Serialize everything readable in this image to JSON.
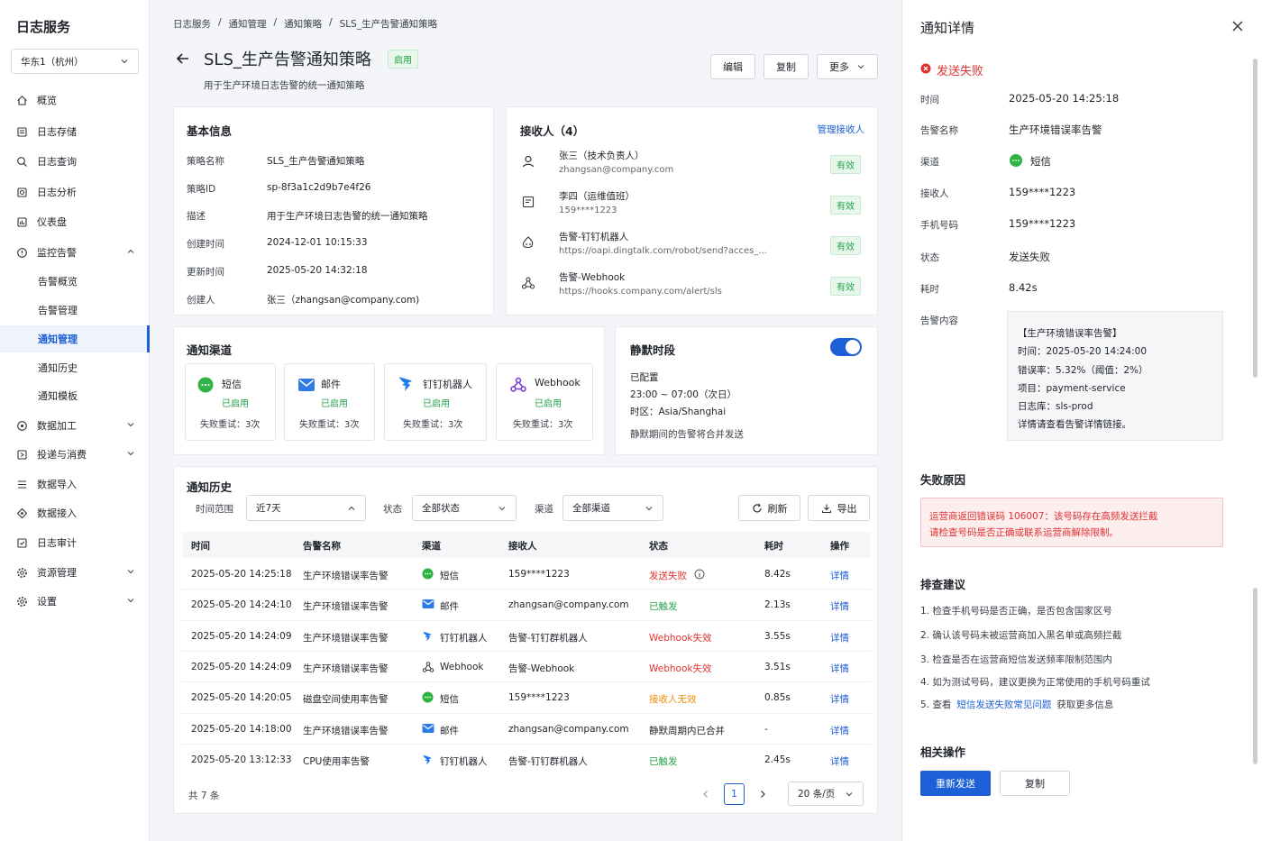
{
  "sidebar": {
    "brand": "日志服务",
    "region": "华东1（杭州）",
    "items": [
      {
        "label": "概览",
        "icon": "home-icon"
      },
      {
        "label": "日志存储",
        "icon": "storage-icon"
      },
      {
        "label": "日志查询",
        "icon": "search-icon"
      },
      {
        "label": "日志分析",
        "icon": "analysis-icon"
      },
      {
        "label": "仪表盘",
        "icon": "dashboard-icon"
      },
      {
        "label": "监控告警",
        "icon": "alert-icon"
      },
      {
        "label": "告警概览"
      },
      {
        "label": "告警管理"
      },
      {
        "label": "通知管理"
      },
      {
        "label": "通知历史"
      },
      {
        "label": "通知模板"
      },
      {
        "label": "数据加工",
        "icon": "process-icon"
      },
      {
        "label": "投递与消费",
        "icon": "deliver-icon"
      },
      {
        "label": "数据导入",
        "icon": "import-icon"
      },
      {
        "label": "数据接入",
        "icon": "access-icon"
      },
      {
        "label": "日志审计",
        "icon": "audit-icon"
      },
      {
        "label": "资源管理",
        "icon": "resource-icon"
      },
      {
        "label": "设置",
        "icon": "gear-icon"
      }
    ]
  },
  "breadcrumb": [
    "日志服务",
    "通知管理",
    "通知策略",
    "SLS_生产告警通知策略"
  ],
  "breadcrumb_sep": "/",
  "header": {
    "title": "SLS_生产告警通知策略",
    "status": "启用",
    "subtitle": "用于生产环境日志告警的统一通知策略",
    "edit": "编辑",
    "copy": "复制",
    "more": "更多"
  },
  "basic": {
    "title": "基本信息",
    "rows": [
      {
        "k": "策略名称",
        "v": "SLS_生产告警通知策略"
      },
      {
        "k": "策略ID",
        "v": "sp-8f3a1c2d9b7e4f26"
      },
      {
        "k": "描述",
        "v": "用于生产环境日志告警的统一通知策略"
      },
      {
        "k": "创建时间",
        "v": "2024-12-01 10:15:33"
      },
      {
        "k": "更新时间",
        "v": "2025-05-20 14:32:18"
      },
      {
        "k": "创建人",
        "v": "张三（zhangsan@company.com)"
      }
    ]
  },
  "receivers": {
    "title": "接收人（4）",
    "manage": "管理接收人",
    "items": [
      {
        "name": "张三（技术负责人）",
        "detail": "zhangsan@company.com",
        "status": "有效",
        "icon": "user-icon"
      },
      {
        "name": "李四（运维值班）",
        "detail": "159****1223",
        "status": "有效",
        "icon": "phone-icon"
      },
      {
        "name": "告警-钉钉机器人",
        "detail": "https://oapi.dingtalk.com/robot/send?acces_...",
        "status": "有效",
        "icon": "robot-icon"
      },
      {
        "name": "告警-Webhook",
        "detail": "https://hooks.company.com/alert/sls",
        "status": "有效",
        "icon": "webhook-icon"
      }
    ]
  },
  "channels": {
    "title": "通知渠道",
    "items": [
      {
        "name": "短信",
        "state": "已启用",
        "retry": "失败重试：3次",
        "icon": "sms-icon",
        "color": "#2fb344"
      },
      {
        "name": "邮件",
        "state": "已启用",
        "retry": "失败重试：3次",
        "icon": "mail-icon",
        "color": "#2f7be5"
      },
      {
        "name": "钉钉机器人",
        "state": "已启用",
        "retry": "失败重试：3次",
        "icon": "dingtalk-icon",
        "color": "#1d7bf0"
      },
      {
        "name": "Webhook",
        "state": "已启用",
        "retry": "失败重试：3次",
        "icon": "webhook-icon",
        "color": "#7b3fd6"
      }
    ]
  },
  "silence": {
    "title": "静默时段",
    "enabled": true,
    "configured": "已配置",
    "range": "23:00 ~ 07:00（次日）",
    "timezone": "时区：Asia/Shanghai",
    "note": "静默期间的告警将合并发送"
  },
  "history": {
    "title": "通知历史",
    "filters": {
      "time_label": "时间范围",
      "time_value": "近7天",
      "status_label": "状态",
      "status_value": "全部状态",
      "channel_label": "渠道",
      "channel_value": "全部渠道",
      "refresh": "刷新",
      "export": "导出"
    },
    "columns": [
      "时间",
      "告警名称",
      "渠道",
      "接收人",
      "状态",
      "耗时",
      "操作"
    ],
    "rows": [
      {
        "time": "2025-05-20 14:25:18",
        "alert": "生产环境错误率告警",
        "channel": "短信",
        "ch_icon": "sms",
        "receiver": "159****1223",
        "status": "发送失败",
        "status_color": "#e03131",
        "cost": "8.42s",
        "op": "详情"
      },
      {
        "time": "2025-05-20 14:24:10",
        "alert": "生产环境错误率告警",
        "channel": "邮件",
        "ch_icon": "mail",
        "receiver": "zhangsan@company.com",
        "status": "已触发",
        "status_color": "#24a148",
        "cost": "2.13s",
        "op": "详情"
      },
      {
        "time": "2025-05-20 14:24:09",
        "alert": "生产环境错误率告警",
        "channel": "钉钉机器人",
        "ch_icon": "ding",
        "receiver": "告警-钉钉群机器人",
        "status": "Webhook失效",
        "status_color": "#e03131",
        "cost": "3.55s",
        "op": "详情"
      },
      {
        "time": "2025-05-20 14:24:09",
        "alert": "生产环境错误率告警",
        "channel": "Webhook",
        "ch_icon": "hook",
        "receiver": "告警-Webhook",
        "status": "Webhook失效",
        "status_color": "#e03131",
        "cost": "3.51s",
        "op": "详情"
      },
      {
        "time": "2025-05-20 14:20:05",
        "alert": "磁盘空间使用率告警",
        "channel": "短信",
        "ch_icon": "sms",
        "receiver": "159****1223",
        "status": "接收人无效",
        "status_color": "#f08c00",
        "cost": "0.85s",
        "op": "详情"
      },
      {
        "time": "2025-05-20 14:18:00",
        "alert": "生产环境错误率告警",
        "channel": "邮件",
        "ch_icon": "mail",
        "receiver": "zhangsan@company.com",
        "status": "静默周期内已合并",
        "status_color": "#1f2329",
        "cost": "-",
        "op": "详情"
      },
      {
        "time": "2025-05-20 13:12:33",
        "alert": "CPU使用率告警",
        "channel": "钉钉机器人",
        "ch_icon": "ding",
        "receiver": "告警-钉钉群机器人",
        "status": "已触发",
        "status_color": "#24a148",
        "cost": "2.45s",
        "op": "详情"
      }
    ],
    "total": "共 7 条",
    "page": "1",
    "page_size": "20 条/页"
  },
  "detail": {
    "title": "通知详情",
    "status": "发送失败",
    "fields": [
      {
        "k": "时间",
        "v": "2025-05-20 14:25:18"
      },
      {
        "k": "告警名称",
        "v": "生产环境错误率告警"
      },
      {
        "k": "渠道",
        "v": "短信"
      },
      {
        "k": "接收人",
        "v": "159****1223"
      },
      {
        "k": "手机号码",
        "v": "159****1223"
      },
      {
        "k": "状态",
        "v": "发送失败"
      },
      {
        "k": "耗时",
        "v": "8.42s"
      }
    ],
    "content_label": "告警内容",
    "content_lines": [
      "【生产环境错误率告警】",
      "时间：2025-05-20 14:24:00",
      "错误率：5.32%（阈值：2%）",
      "项目：payment-service",
      "日志库：sls-prod",
      "详情请查看告警详情链接。"
    ],
    "fail_title": "失败原因",
    "fail_lines": [
      "运营商返回错误码 106007：该号码存在高频发送拦截",
      "请检查号码是否正确或联系运营商解除限制。"
    ],
    "suggest_title": "排查建议",
    "suggestions": [
      "1.  检查手机号码是否正确，是否包含国家区号",
      "2.  确认该号码未被运营商加入黑名单或高频拦截",
      "3.  检查是否在运营商短信发送频率限制范围内",
      "4.  如为测试号码，建议更换为正常使用的手机号码重试"
    ],
    "suggestion5_prefix": "5.  查看",
    "suggestion5_link": "短信发送失败常见问题",
    "suggestion5_suffix": "获取更多信息",
    "actions_title": "相关操作",
    "resend": "重新发送",
    "copy": "复制"
  }
}
